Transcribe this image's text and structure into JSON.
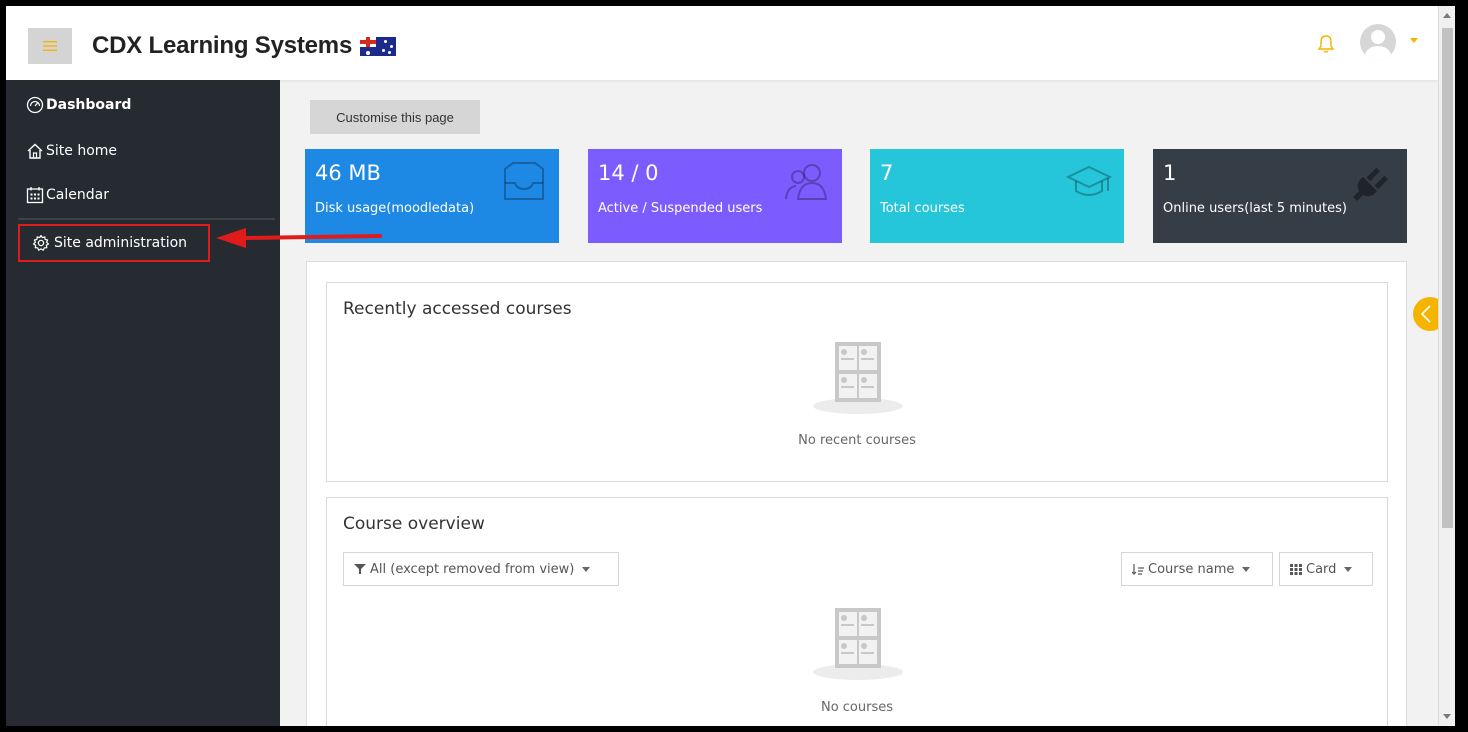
{
  "header": {
    "brand_name": "CDX Learning Systems",
    "brand_mark": "CDX",
    "brand_rest": " Learning Systems",
    "menu_icon": "hamburger-icon",
    "notification_icon": "bell-icon",
    "avatar_icon": "user-avatar-icon"
  },
  "sidebar": {
    "items": [
      {
        "label": "Dashboard",
        "icon": "dashboard-gauge-icon"
      },
      {
        "label": "Site home",
        "icon": "home-icon"
      },
      {
        "label": "Calendar",
        "icon": "calendar-icon"
      },
      {
        "label": "Site administration",
        "icon": "gear-icon"
      }
    ]
  },
  "main": {
    "customise_label": "Customise this page",
    "stats": [
      {
        "value": "46 MB",
        "label": "Disk usage(moodledata)",
        "icon": "inbox-icon",
        "color": "#1e88e5"
      },
      {
        "value": "14 / 0",
        "label": "Active / Suspended users",
        "icon": "users-icon",
        "color": "#7c5cff"
      },
      {
        "value": "7",
        "label": "Total courses",
        "icon": "graduation-cap-icon",
        "color": "#26c6da"
      },
      {
        "value": "1",
        "label": "Online users(last 5 minutes)",
        "icon": "plug-icon",
        "color": "#353d47"
      }
    ],
    "recent": {
      "title": "Recently accessed courses",
      "empty_text": "No recent courses"
    },
    "overview": {
      "title": "Course overview",
      "filter_label": "All (except removed from view)",
      "sort_label": "Course name",
      "view_label": "Card",
      "empty_text": "No courses"
    }
  },
  "colors": {
    "accent": "#f4b400",
    "sidebar_bg": "#262b31",
    "highlight_border": "#e01b1b"
  }
}
